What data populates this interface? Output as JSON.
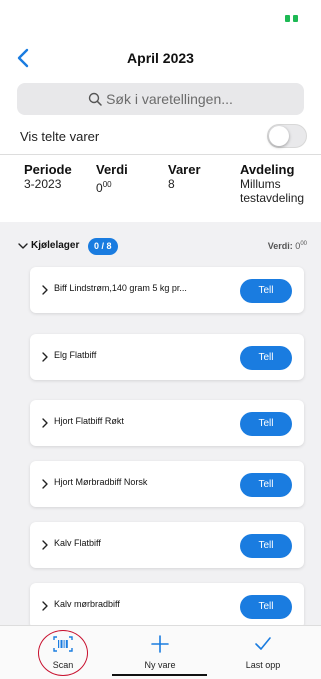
{
  "colors": {
    "accent": "#1a7ce0",
    "battery": "#1db954",
    "scan_circle": "#c8102e"
  },
  "nav": {
    "back_icon": "chevron-left-icon",
    "title": "April 2023"
  },
  "search": {
    "icon": "search-icon",
    "placeholder": "Søk i varetellingen..."
  },
  "filter": {
    "label": "Vis telte varer",
    "enabled": false
  },
  "summary": {
    "periode": {
      "label": "Periode",
      "value": "3-2023"
    },
    "verdi": {
      "label": "Verdi",
      "value": "0",
      "sup": "00"
    },
    "varer": {
      "label": "Varer",
      "value": "8"
    },
    "avdeling": {
      "label": "Avdeling",
      "line1": "Millums",
      "line2": "testavdeling"
    }
  },
  "group": {
    "name": "Kjølelager",
    "badge": "0 / 8",
    "value_label": "Verdi:",
    "value": "0",
    "value_sup": "00"
  },
  "items": [
    {
      "name": "Biff Lindstrøm,140 gram 5 kg pr...",
      "button": "Tell"
    },
    {
      "name": "Elg Flatbiff",
      "button": "Tell"
    },
    {
      "name": "Hjort Flatbiff Røkt",
      "button": "Tell"
    },
    {
      "name": "Hjort Mørbradbiff Norsk",
      "button": "Tell"
    },
    {
      "name": "Kalv Flatbiff",
      "button": "Tell"
    },
    {
      "name": "Kalv mørbradbiff",
      "button": "Tell"
    }
  ],
  "tabbar": {
    "scan": {
      "label": "Scan",
      "icon": "barcode-scan-icon"
    },
    "new": {
      "label": "Ny vare",
      "icon": "plus-icon"
    },
    "upload": {
      "label": "Last opp",
      "icon": "checkmark-icon"
    }
  }
}
